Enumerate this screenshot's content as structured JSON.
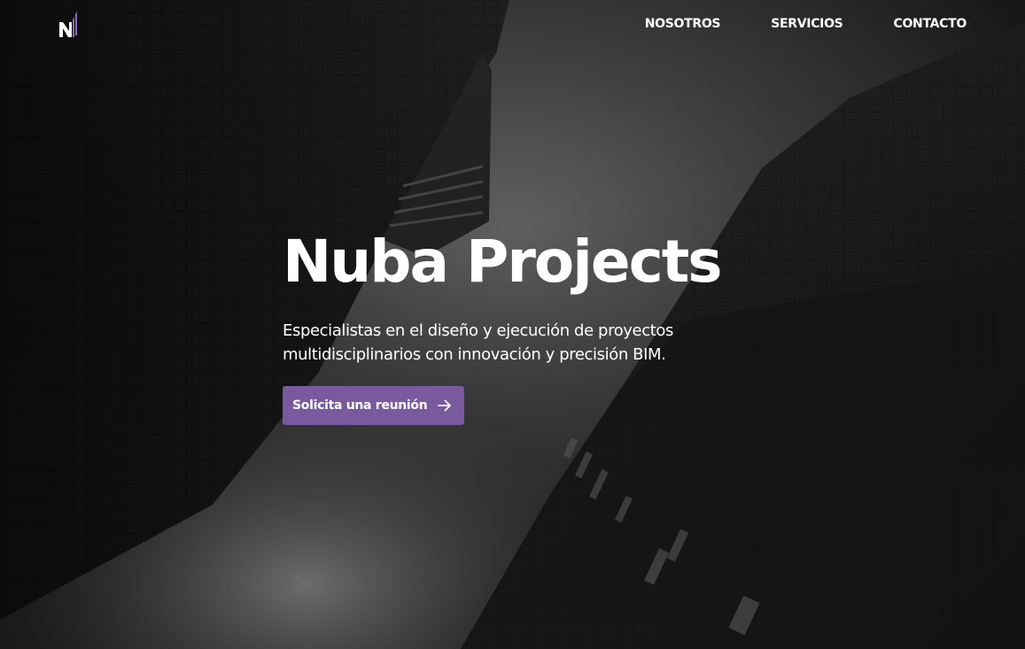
{
  "header": {
    "logo_name": "nuba-logo",
    "nav": [
      {
        "label": "NOSOTROS"
      },
      {
        "label": "SERVICIOS"
      },
      {
        "label": "CONTACTO"
      }
    ]
  },
  "hero": {
    "title": "Nuba Projects",
    "subtitle": "Especialistas en el diseño y ejecución de proyectos multidisciplinarios con innovación y precisión BIM.",
    "cta_label": "Solicita una reunión",
    "cta_icon": "arrow-right-icon"
  },
  "colors": {
    "accent": "#7a5a9e",
    "text": "#ffffff",
    "background": "#111111"
  }
}
